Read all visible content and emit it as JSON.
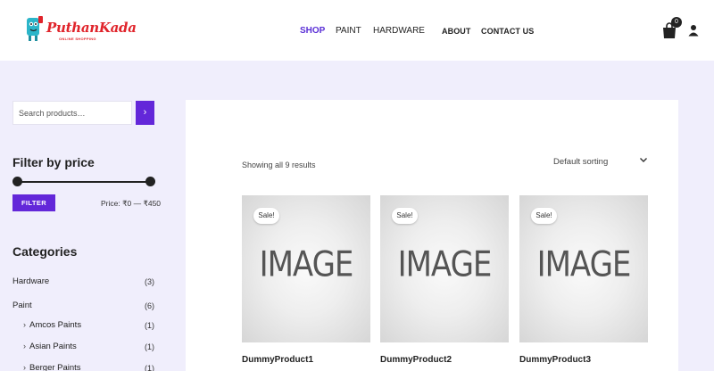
{
  "brand": {
    "name": "PuthanKada",
    "tagline": "ONLINE SHOPPING"
  },
  "nav": {
    "shop": "SHOP",
    "paint": "PAINT",
    "hardware": "HARDWARE",
    "about": "ABOUT",
    "contact": "CONTACT US"
  },
  "cart": {
    "count": "0"
  },
  "search": {
    "placeholder": "Search products…"
  },
  "price_filter": {
    "title": "Filter by price",
    "button": "FILTER",
    "label": "Price: ₹0 — ₹450",
    "range_min_fraction": 0,
    "range_max_fraction": 1
  },
  "categories": {
    "title": "Categories",
    "items": [
      {
        "label": "Hardware",
        "count": "(3)"
      },
      {
        "label": "Paint",
        "count": "(6)"
      },
      {
        "label": "Amcos Paints",
        "count": "(1)"
      },
      {
        "label": "Asian Paints",
        "count": "(1)"
      },
      {
        "label": "Berger Paints",
        "count": "(1)"
      }
    ]
  },
  "shop": {
    "result_count": "Showing all 9 results",
    "sorting": "Default sorting"
  },
  "products": [
    {
      "name": "DummyProduct1",
      "badge": "Sale!",
      "image_text": "IMAGE"
    },
    {
      "name": "DummyProduct2",
      "badge": "Sale!",
      "image_text": "IMAGE"
    },
    {
      "name": "DummyProduct3",
      "badge": "Sale!",
      "image_text": "IMAGE"
    }
  ],
  "colors": {
    "accent": "#6327d9",
    "active_nav": "#5a2fd6",
    "background": "#f0eefc",
    "brand_red": "#e0242b"
  }
}
